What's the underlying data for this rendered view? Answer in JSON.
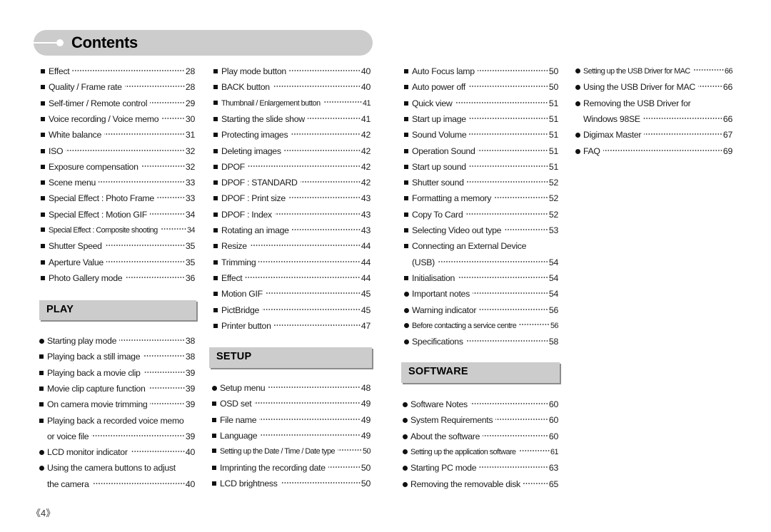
{
  "header": {
    "title": "Contents"
  },
  "columns": [
    {
      "entries": [
        {
          "bullet": "square",
          "label": "Effect",
          "page": "28"
        },
        {
          "bullet": "square",
          "label": "Quality / Frame rate",
          "page": "28"
        },
        {
          "bullet": "square",
          "label": "Self-timer / Remote control",
          "page": "29"
        },
        {
          "bullet": "square",
          "label": "Voice recording / Voice memo",
          "page": "30"
        },
        {
          "bullet": "square",
          "label": "White balance",
          "page": "31"
        },
        {
          "bullet": "square",
          "label": "ISO",
          "page": "32"
        },
        {
          "bullet": "square",
          "label": "Exposure compensation",
          "page": "32"
        },
        {
          "bullet": "square",
          "label": "Scene menu",
          "page": "33"
        },
        {
          "bullet": "square",
          "label": "Special Effect : Photo Frame",
          "page": "33"
        },
        {
          "bullet": "square",
          "label": "Special Effect : Motion GIF",
          "page": "34"
        },
        {
          "bullet": "square",
          "label": "Special Effect : Composite shooting",
          "page": "34",
          "small": true
        },
        {
          "bullet": "square",
          "label": "Shutter Speed",
          "page": "35"
        },
        {
          "bullet": "square",
          "label": "Aperture Value",
          "page": "35"
        },
        {
          "bullet": "square",
          "label": "Photo Gallery mode",
          "page": "36"
        }
      ],
      "section": {
        "title": "PLAY",
        "entries": [
          {
            "bullet": "circle",
            "label": "Starting play mode",
            "page": "38"
          },
          {
            "bullet": "square",
            "label": "Playing back a still image",
            "page": "38"
          },
          {
            "bullet": "square",
            "label": "Playing back a movie clip",
            "page": "39"
          },
          {
            "bullet": "square",
            "label": "Movie clip capture function",
            "page": "39"
          },
          {
            "bullet": "square",
            "label": "On camera movie trimming",
            "page": "39"
          },
          {
            "bullet": "square",
            "label": "Playing back a recorded voice memo",
            "page": ""
          },
          {
            "bullet": "none",
            "label": "or voice file",
            "page": "39"
          },
          {
            "bullet": "circle",
            "label": "LCD monitor indicator",
            "page": "40"
          },
          {
            "bullet": "circle",
            "label": "Using the camera buttons to adjust",
            "page": ""
          },
          {
            "bullet": "none",
            "label": "the camera",
            "page": "40"
          }
        ]
      }
    },
    {
      "entries": [
        {
          "bullet": "square",
          "label": "Play mode button",
          "page": "40"
        },
        {
          "bullet": "square",
          "label": "BACK button",
          "page": "40"
        },
        {
          "bullet": "square",
          "label": "Thumbnail / Enlargement button",
          "page": "41",
          "small": true
        },
        {
          "bullet": "square",
          "label": "Starting the slide show",
          "page": "41"
        },
        {
          "bullet": "square",
          "label": "Protecting images",
          "page": "42"
        },
        {
          "bullet": "square",
          "label": "Deleting images",
          "page": "42"
        },
        {
          "bullet": "square",
          "label": "DPOF",
          "page": "42"
        },
        {
          "bullet": "square",
          "label": "DPOF : STANDARD",
          "page": "42"
        },
        {
          "bullet": "square",
          "label": "DPOF : Print size",
          "page": "43"
        },
        {
          "bullet": "square",
          "label": "DPOF : Index",
          "page": "43"
        },
        {
          "bullet": "square",
          "label": "Rotating an image",
          "page": "43"
        },
        {
          "bullet": "square",
          "label": "Resize",
          "page": "44"
        },
        {
          "bullet": "square",
          "label": "Trimming",
          "page": "44"
        },
        {
          "bullet": "square",
          "label": "Effect",
          "page": "44"
        },
        {
          "bullet": "square",
          "label": "Motion GIF",
          "page": "45"
        },
        {
          "bullet": "square",
          "label": "PictBridge",
          "page": "45"
        },
        {
          "bullet": "square",
          "label": "Printer button",
          "page": "47"
        }
      ],
      "section": {
        "title": "SETUP",
        "entries": [
          {
            "bullet": "circle",
            "label": "Setup menu",
            "page": "48"
          },
          {
            "bullet": "square",
            "label": "OSD set",
            "page": "49"
          },
          {
            "bullet": "square",
            "label": "File name",
            "page": "49"
          },
          {
            "bullet": "square",
            "label": "Language",
            "page": "49"
          },
          {
            "bullet": "square",
            "label": "Setting up the Date / Time / Date type",
            "page": "50",
            "small": true
          },
          {
            "bullet": "square",
            "label": "Imprinting the recording date",
            "page": "50"
          },
          {
            "bullet": "square",
            "label": "LCD brightness",
            "page": "50"
          }
        ]
      }
    },
    {
      "entries": [
        {
          "bullet": "square",
          "label": "Auto Focus lamp",
          "page": "50"
        },
        {
          "bullet": "square",
          "label": "Auto power off",
          "page": "50"
        },
        {
          "bullet": "square",
          "label": "Quick view",
          "page": "51"
        },
        {
          "bullet": "square",
          "label": "Start up image",
          "page": "51"
        },
        {
          "bullet": "square",
          "label": "Sound Volume",
          "page": "51"
        },
        {
          "bullet": "square",
          "label": "Operation Sound",
          "page": "51"
        },
        {
          "bullet": "square",
          "label": "Start up sound",
          "page": "51"
        },
        {
          "bullet": "square",
          "label": "Shutter sound",
          "page": "52"
        },
        {
          "bullet": "square",
          "label": "Formatting a memory",
          "page": "52"
        },
        {
          "bullet": "square",
          "label": "Copy To Card",
          "page": "52"
        },
        {
          "bullet": "square",
          "label": "Selecting Video out type",
          "page": "53"
        },
        {
          "bullet": "square",
          "label": "Connecting an External Device",
          "page": ""
        },
        {
          "bullet": "none",
          "label": "(USB)",
          "page": "54"
        },
        {
          "bullet": "square",
          "label": "Initialisation",
          "page": "54"
        },
        {
          "bullet": "circle",
          "label": "Important notes",
          "page": "54"
        },
        {
          "bullet": "circle",
          "label": "Warning indicator",
          "page": "56"
        },
        {
          "bullet": "circle",
          "label": "Before contacting a service centre",
          "page": "56",
          "small": true
        },
        {
          "bullet": "circle",
          "label": "Specifications",
          "page": "58"
        }
      ],
      "section": {
        "title": "SOFTWARE",
        "entries": [
          {
            "bullet": "circle",
            "label": "Software Notes",
            "page": "60"
          },
          {
            "bullet": "circle",
            "label": "System Requirements",
            "page": "60"
          },
          {
            "bullet": "circle",
            "label": "About the software",
            "page": "60"
          },
          {
            "bullet": "circle",
            "label": "Setting up the application software",
            "page": "61",
            "small": true
          },
          {
            "bullet": "circle",
            "label": "Starting PC mode",
            "page": "63"
          },
          {
            "bullet": "circle",
            "label": "Removing the removable disk",
            "page": "65"
          }
        ]
      }
    },
    {
      "entries": [
        {
          "bullet": "circle",
          "label": "Setting up the USB Driver for MAC",
          "page": "66",
          "small": true
        },
        {
          "bullet": "circle",
          "label": "Using the USB Driver for MAC",
          "page": "66"
        },
        {
          "bullet": "circle",
          "label": "Removing the USB Driver for",
          "page": ""
        },
        {
          "bullet": "none",
          "label": "Windows 98SE",
          "page": "66"
        },
        {
          "bullet": "circle",
          "label": "Digimax Master",
          "page": "67"
        },
        {
          "bullet": "circle",
          "label": "FAQ",
          "page": "69"
        }
      ]
    }
  ],
  "footer": {
    "page_number": "《4》"
  }
}
